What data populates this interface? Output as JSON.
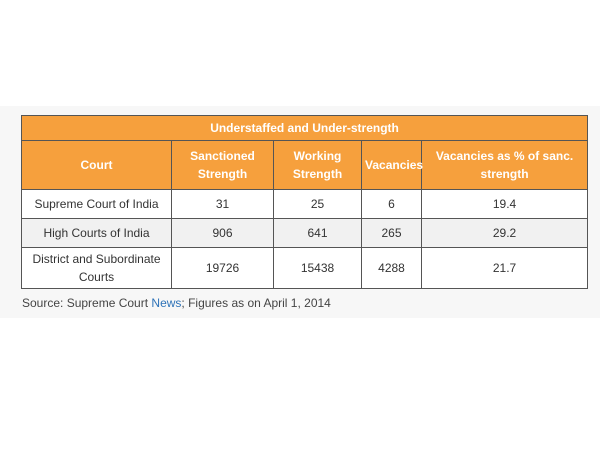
{
  "table": {
    "title": "Understaffed and Under-strength",
    "headers": [
      "Court",
      "Sanctioned Strength",
      "Working Strength",
      "Vacancies",
      "Vacancies as % of sanc. strength"
    ],
    "rows": [
      [
        "Supreme Court of India",
        "31",
        "25",
        "6",
        "19.4"
      ],
      [
        "High Courts of India",
        "906",
        "641",
        "265",
        "29.2"
      ],
      [
        "District and Subordinate Courts",
        "19726",
        "15438",
        "4288",
        "21.7"
      ]
    ]
  },
  "source": {
    "prefix": "Source:  Supreme Court ",
    "link_text": "News",
    "suffix": "; Figures as on April 1, 2014"
  },
  "colors": {
    "header_bg": "#f6a03d",
    "header_text": "#ffffff",
    "link": "#2e73b8"
  }
}
